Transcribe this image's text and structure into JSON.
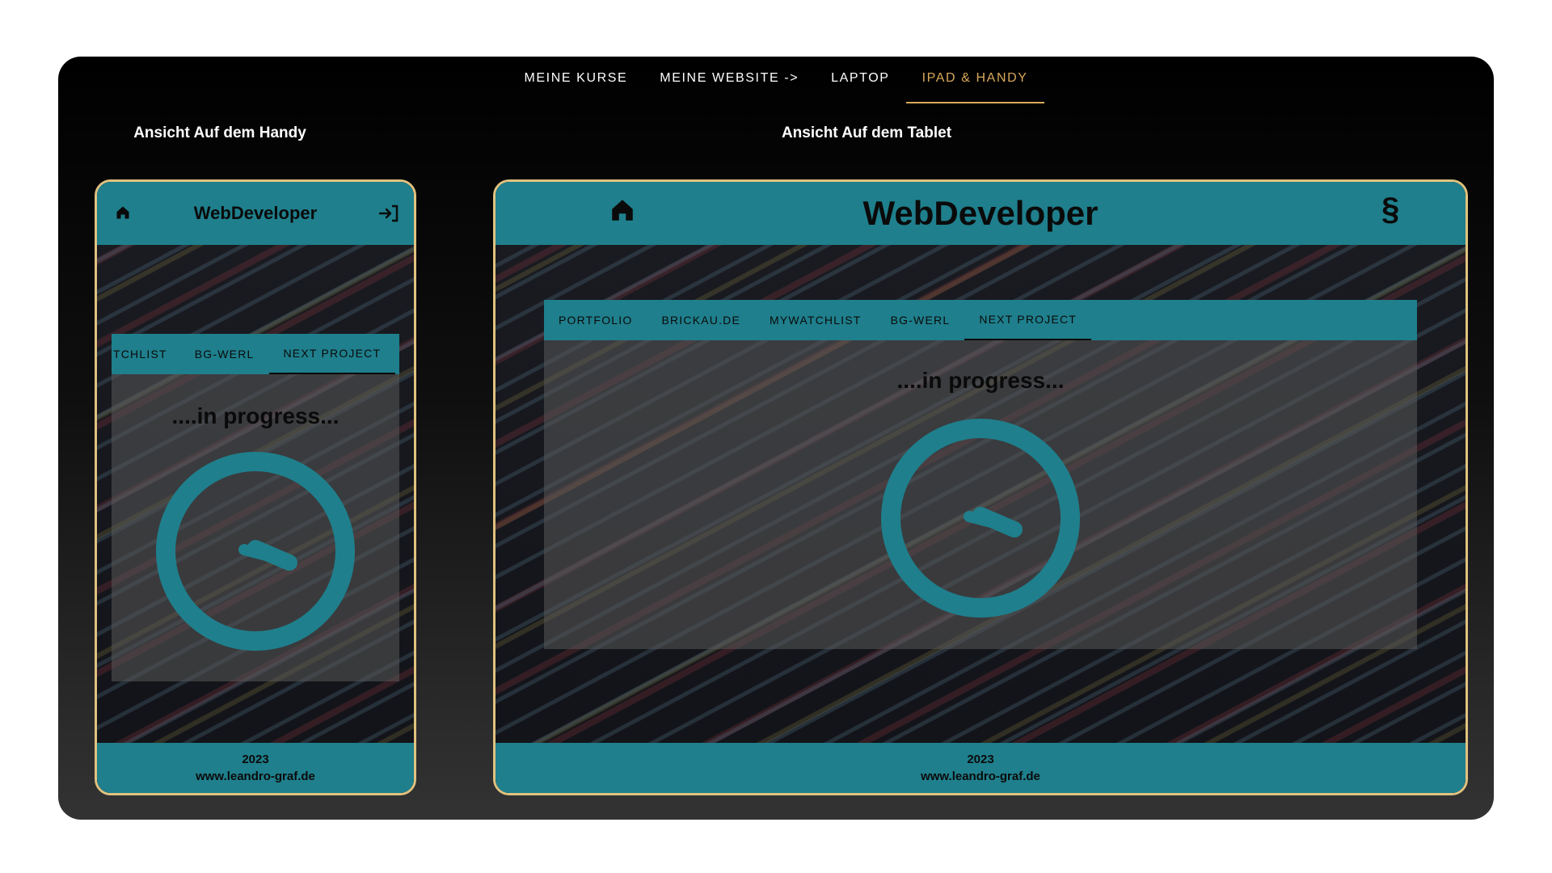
{
  "nav": {
    "items": [
      {
        "label": "MEINE KURSE",
        "active": false
      },
      {
        "label": "MEINE WEBSITE ->",
        "active": false
      },
      {
        "label": "LAPTOP",
        "active": false
      },
      {
        "label": "IPAD & HANDY",
        "active": true
      }
    ]
  },
  "phone": {
    "title": "Ansicht Auf dem Handy",
    "brand": "WebDeveloper",
    "tabs": [
      {
        "label": "TCHLIST",
        "active": false
      },
      {
        "label": "BG-WERL",
        "active": false
      },
      {
        "label": "NEXT PROJECT",
        "active": true
      }
    ],
    "progress": "....in progress...",
    "footer_year": "2023",
    "footer_url": "www.leandro-graf.de",
    "icons": {
      "left": "home-icon",
      "right": "logout-icon"
    }
  },
  "tablet": {
    "title": "Ansicht Auf dem Tablet",
    "brand": "WebDeveloper",
    "tabs": [
      {
        "label": "PORTFOLIO",
        "active": false
      },
      {
        "label": "BRICKAU.DE",
        "active": false
      },
      {
        "label": "MYWATCHLIST",
        "active": false
      },
      {
        "label": "BG-WERL",
        "active": false
      },
      {
        "label": "NEXT PROJECT",
        "active": true
      }
    ],
    "progress": "....in progress...",
    "footer_year": "2023",
    "footer_url": "www.leandro-graf.de",
    "icons": {
      "left": "home-icon",
      "right": "section-sign-icon"
    },
    "section_glyph": "§"
  },
  "colors": {
    "accent": "#1f7f8c",
    "gold": "#d9a95b",
    "border": "#e0c27f"
  }
}
